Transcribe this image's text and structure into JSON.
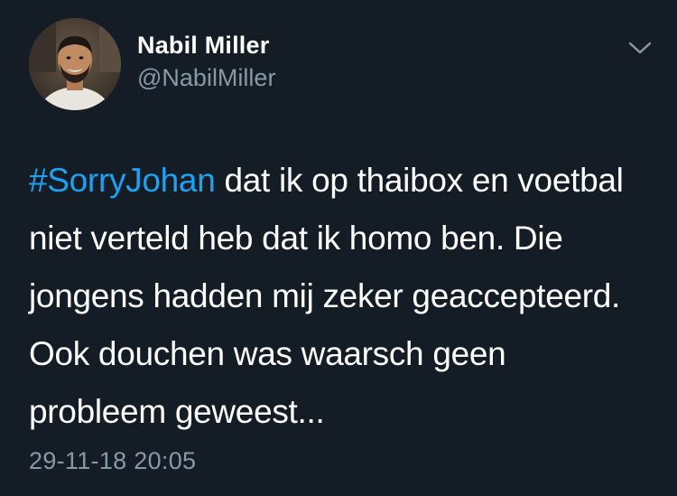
{
  "tweet": {
    "author": {
      "display_name": "Nabil Miller",
      "handle": "@NabilMiller"
    },
    "menu_icon": "chevron-down-icon",
    "hashtag": "#SorryJohan",
    "text": " dat ik op thaibox en voetbal niet verteld heb dat ik homo ben. Die jongens hadden mij zeker geaccepteerd. Ook douchen was waarsch geen probleem geweest...",
    "timestamp": "29-11-18 20:05"
  },
  "colors": {
    "background": "#141d26",
    "text": "#ffffff",
    "secondary_text": "#8899a6",
    "accent": "#1da1f2"
  }
}
